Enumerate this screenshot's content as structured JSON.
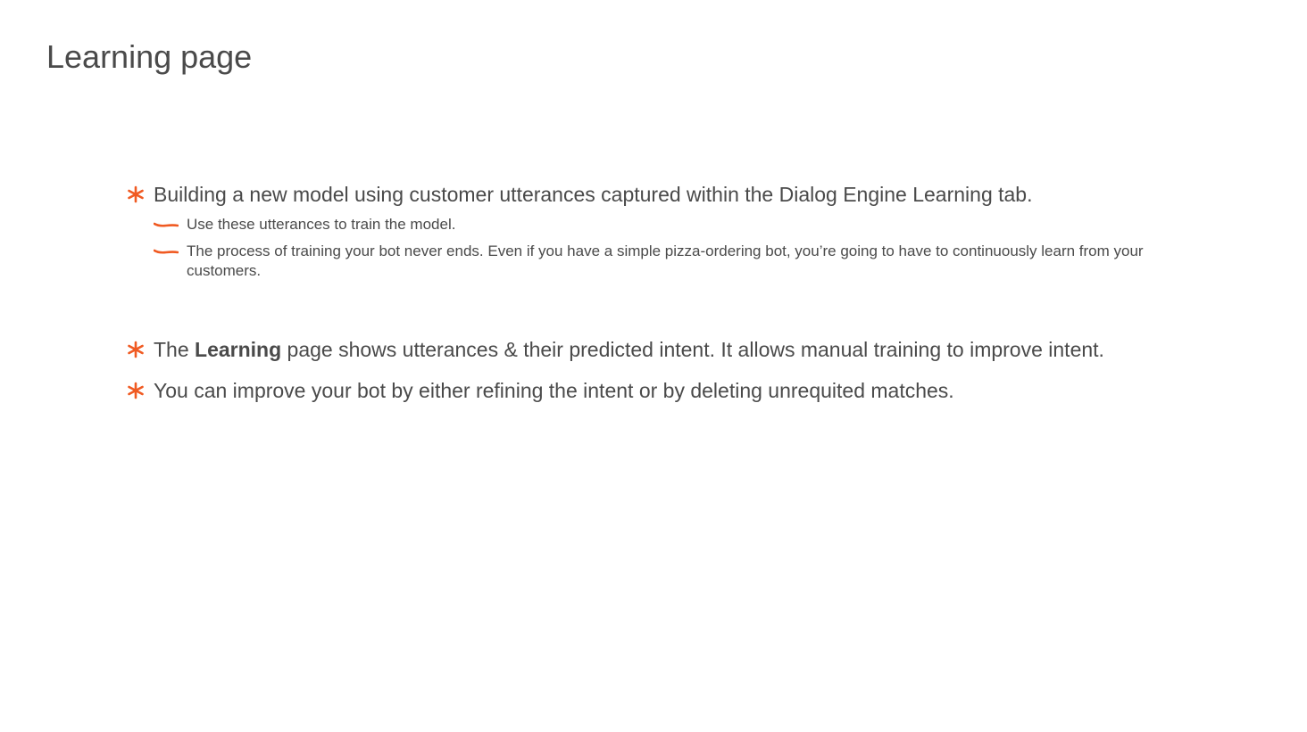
{
  "slide": {
    "title": "Learning page",
    "accent_color": "#f05a22",
    "bullet_icon": "asterisk-icon",
    "sub_bullet_icon": "brush-dash-icon"
  },
  "bullets": [
    {
      "text": "Building a new model using customer utterances captured within the Dialog Engine Learning tab.",
      "sub_bullets": [
        "Use these utterances to train the model.",
        "The process of training your bot never ends. Even if you have a simple pizza-ordering bot, you’re going to have to continuously learn from your customers."
      ]
    },
    {
      "prefix": "The ",
      "bold": "Learning",
      "suffix": " page shows utterances & their predicted intent. It allows manual training to improve intent."
    },
    {
      "text": "You can improve your bot by either refining the intent or by deleting unrequited matches."
    }
  ]
}
